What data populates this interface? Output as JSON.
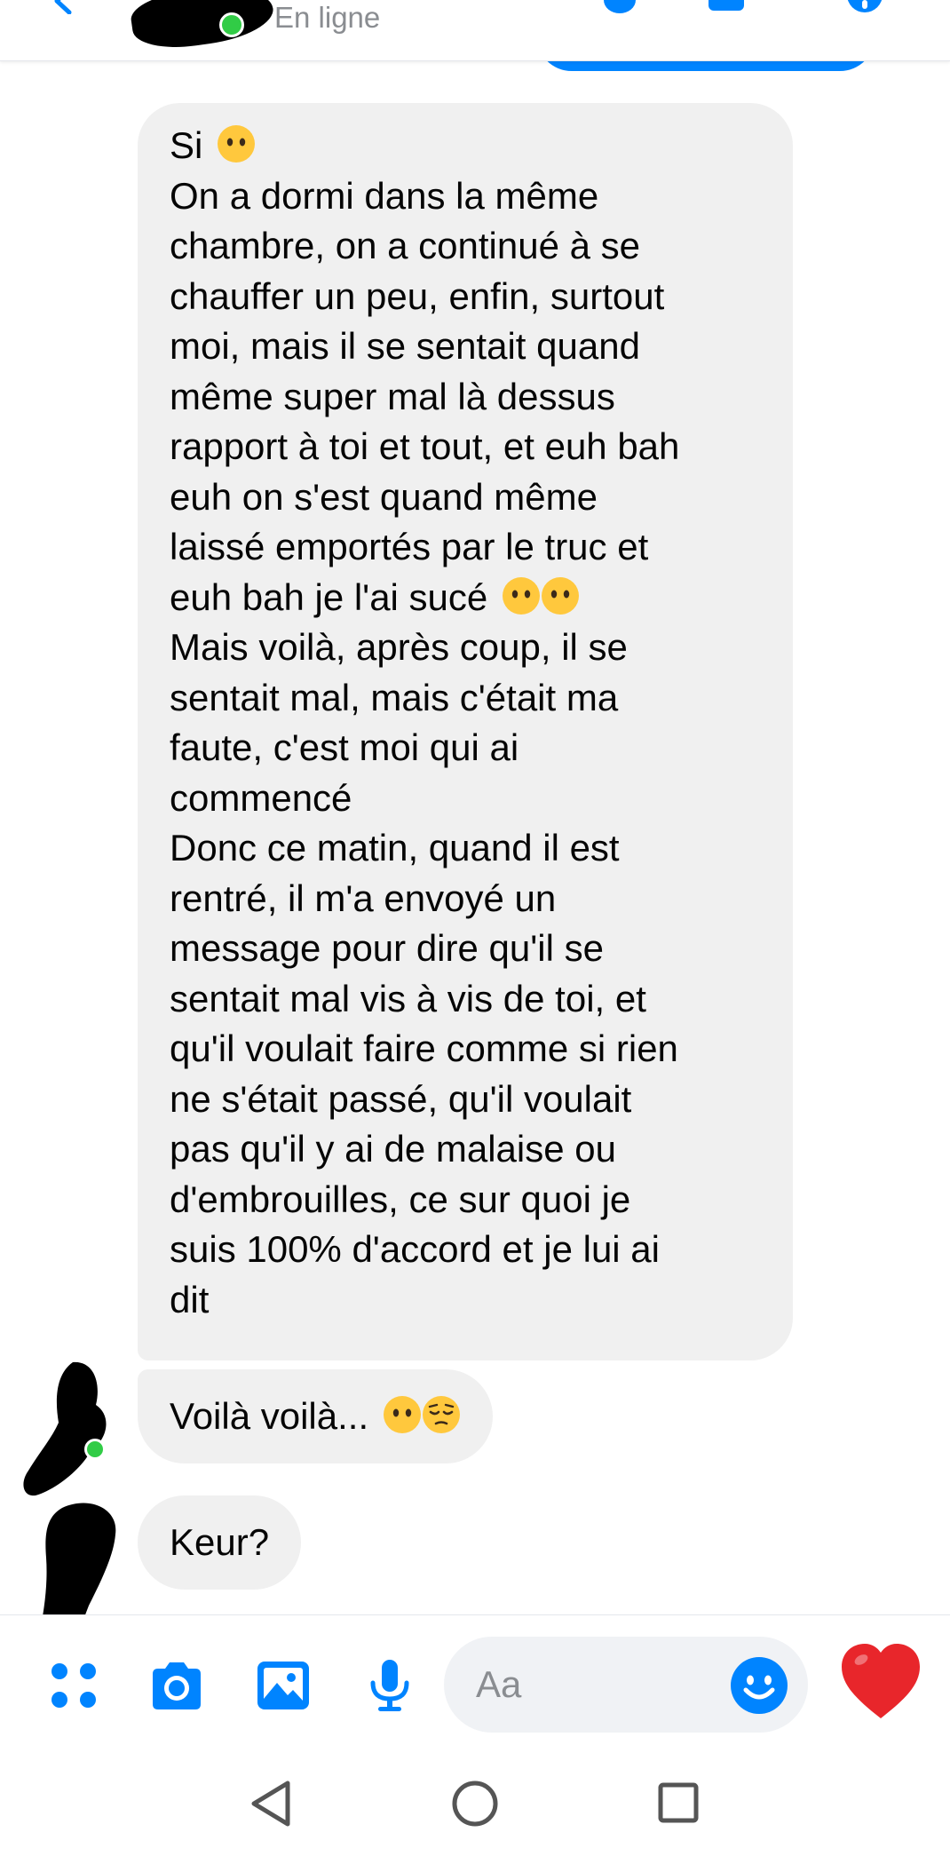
{
  "header": {
    "status": "En ligne",
    "icons": {
      "back": "back-arrow-icon",
      "call": "phone-icon",
      "video": "video-camera-icon",
      "info": "info-icon"
    },
    "presence_color": "#31cc46"
  },
  "messages": [
    {
      "lines": [
        "Si",
        "On a dormi dans la même",
        "chambre, on a continué à se",
        "chauffer un peu, enfin, surtout",
        "moi, mais il se sentait quand",
        "même super mal là dessus",
        "rapport à toi et tout, et euh bah",
        "euh on s'est quand même",
        "laissé emportés par le truc et",
        "euh bah je l'ai sucé",
        "Mais voilà, après coup, il se",
        "sentait mal, mais c'était ma",
        "faute, c'est moi qui ai",
        "commencé",
        "Donc ce matin, quand il est",
        "rentré, il m'a envoyé un",
        "message pour dire qu'il se",
        "sentait mal vis à vis de toi, et",
        "qu'il voulait faire comme si rien",
        "ne s'était passé, qu'il voulait",
        "pas qu'il y ai de malaise ou",
        "d'embrouilles, ce sur quoi je",
        "suis 100% d'accord et je lui ai",
        "dit"
      ],
      "emojis": {
        "line_0": [
          "neutral-face-no-mouth"
        ],
        "line_9": [
          "neutral-face-no-mouth",
          "neutral-face-no-mouth"
        ]
      }
    },
    {
      "text": "Voilà voilà...",
      "emojis": [
        "neutral-face-no-mouth",
        "pensive-face"
      ]
    },
    {
      "text": "Keur?"
    }
  ],
  "composer": {
    "placeholder": "Aa",
    "icons": [
      "apps-icon",
      "camera-icon",
      "gallery-icon",
      "microphone-icon",
      "emoji-icon",
      "heart-icon"
    ],
    "accent": "#0084ff",
    "heart_color": "#e8262b"
  },
  "navbar": {
    "icons": [
      "back-triangle-icon",
      "home-circle-icon",
      "recent-square-icon"
    ]
  },
  "colors": {
    "bubble_incoming": "#f0f0f0",
    "text": "#050505",
    "muted": "#8a8d91"
  }
}
